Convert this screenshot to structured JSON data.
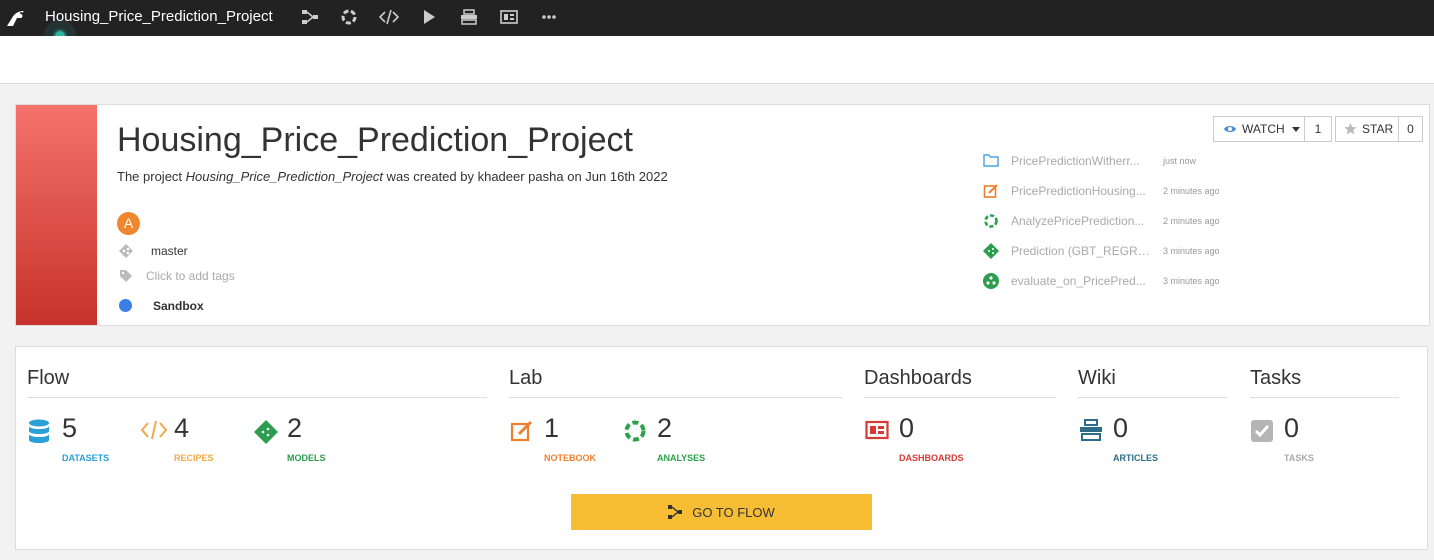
{
  "topbar": {
    "project_title": "Housing_Price_Prediction_Project",
    "icons": [
      "flow-icon",
      "lab-icon",
      "code-icon",
      "run-icon",
      "wiki-icon",
      "dashboard-icon",
      "more-icon"
    ]
  },
  "project": {
    "title": "Housing_Price_Prediction_Project",
    "subtitle_prefix": "The project ",
    "subtitle_project": "Housing_Price_Prediction_Project",
    "subtitle_suffix": " was created by khadeer pasha on Jun 16th 2022",
    "avatar_letter": "A",
    "branch": "master",
    "tags_placeholder": "Click to add tags",
    "sandbox": "Sandbox",
    "accent_color": "#e0463e"
  },
  "social": {
    "watch_label": "WATCH",
    "watch_count": "1",
    "star_label": "STAR",
    "star_count": "0"
  },
  "activity": [
    {
      "name": "PricePredictionWitherr...",
      "time": "just now",
      "icon": "folder-icon"
    },
    {
      "name": "PricePredictionHousing...",
      "time": "2 minutes ago",
      "icon": "notebook-icon"
    },
    {
      "name": "AnalyzePricePrediction...",
      "time": "2 minutes ago",
      "icon": "analysis-icon"
    },
    {
      "name": "Prediction (GBT_REGRE...",
      "time": "3 minutes ago",
      "icon": "model-icon"
    },
    {
      "name": "evaluate_on_PricePred...",
      "time": "3 minutes ago",
      "icon": "evaluate-icon"
    }
  ],
  "sections": {
    "flow": "Flow",
    "lab": "Lab",
    "dashboards": "Dashboards",
    "wiki": "Wiki",
    "tasks": "Tasks"
  },
  "stats": {
    "datasets": {
      "count": "5",
      "label": "DATASETS",
      "color": "#2a9fd8"
    },
    "recipes": {
      "count": "4",
      "label": "RECIPES",
      "color": "#f2a94a"
    },
    "models": {
      "count": "2",
      "label": "MODELS",
      "color": "#2c9d4f"
    },
    "notebook": {
      "count": "1",
      "label": "NOTEBOOK",
      "color": "#ee7f2d"
    },
    "analyses": {
      "count": "2",
      "label": "ANALYSES",
      "color": "#2aa24a"
    },
    "dashboards": {
      "count": "0",
      "label": "DASHBOARDS",
      "color": "#d63a35"
    },
    "articles": {
      "count": "0",
      "label": "ARTICLES",
      "color": "#2c6e8a"
    },
    "tasks": {
      "count": "0",
      "label": "TASKS",
      "color": "#aaaaaa"
    }
  },
  "go_to_flow": "GO TO FLOW"
}
